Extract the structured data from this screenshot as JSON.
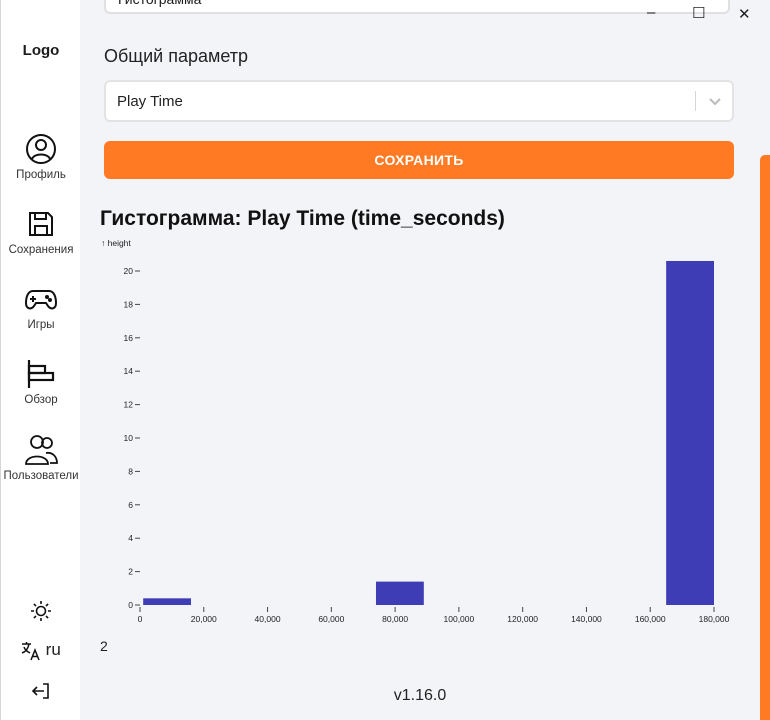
{
  "sidebar": {
    "logo": "Logo",
    "items": [
      {
        "label": "Профиль",
        "icon": "user-circle-icon"
      },
      {
        "label": "Сохранения",
        "icon": "floppy-disk-icon"
      },
      {
        "label": "Игры",
        "icon": "gamepad-icon"
      },
      {
        "label": "Обзор",
        "icon": "bar-chart-icon"
      },
      {
        "label": "Пользователи",
        "icon": "users-icon"
      }
    ],
    "language": "ru",
    "theme_icon": "sun-icon",
    "logout_icon": "logout-icon"
  },
  "top_field": {
    "value": "Гистограмма"
  },
  "window_controls": {
    "minimize": "–",
    "maximize": "☐",
    "close": "✕"
  },
  "form": {
    "param_label": "Общий параметр",
    "select_value": "Play Time",
    "save_label": "СОХРАНИТЬ"
  },
  "chart_data": {
    "type": "bar",
    "title": "Гистограмма: Play Time (time_seconds)",
    "ylabel": "↑ height",
    "xlabel": "",
    "xlim": [
      0,
      180000
    ],
    "ylim": [
      0,
      20
    ],
    "x_ticks": [
      "0",
      "20,000",
      "40,000",
      "60,000",
      "80,000",
      "100,000",
      "120,000",
      "140,000",
      "160,000",
      "180,000"
    ],
    "y_ticks": [
      "0",
      "2",
      "4",
      "6",
      "8",
      "10",
      "12",
      "14",
      "16",
      "18",
      "20"
    ],
    "bins": [
      {
        "x0": 1000,
        "x1": 16000,
        "value": 0.4
      },
      {
        "x0": 74000,
        "x1": 89000,
        "value": 1.4
      },
      {
        "x0": 165000,
        "x1": 180000,
        "value": 20.6
      }
    ],
    "bar_color": "#3f3db5"
  },
  "footer_count": "2",
  "version": "v1.16.0"
}
